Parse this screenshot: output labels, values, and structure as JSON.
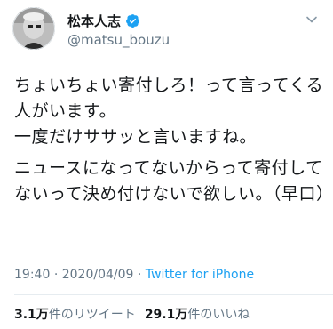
{
  "author": {
    "display_name": "松本人志",
    "handle": "@matsu_bouzu",
    "verified": true
  },
  "tweet": {
    "paragraphs": [
      "ちょいちょい寄付しろ！って言ってくる人がいます。\n一度だけササッと言いますね。",
      "ニュースになってないからって寄付してないって決め付けないで欲しい。（早口）"
    ],
    "time": "19:40",
    "separator": "·",
    "date": "2020/04/09",
    "source": "Twitter for iPhone"
  },
  "stats": {
    "retweets_count": "3.1万",
    "retweets_label": "件のリツイート",
    "likes_count": "29.1万",
    "likes_label": "件のいいね"
  },
  "colors": {
    "text": "#14171a",
    "secondary": "#657786",
    "accent": "#1da1f2",
    "divider": "#e6ecf0"
  },
  "icons": {
    "verified": "verified-badge-icon",
    "menu": "caret-down-icon"
  }
}
